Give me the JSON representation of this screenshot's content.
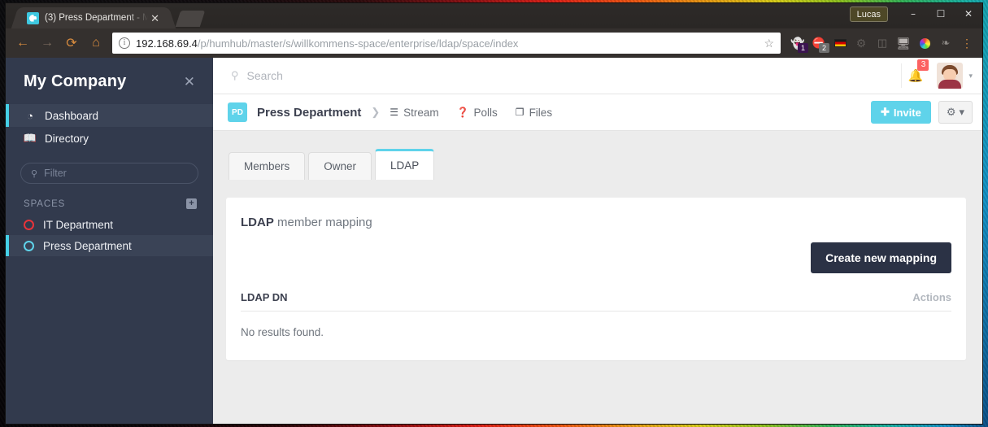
{
  "browser": {
    "tab": {
      "title": "(3) Press Department - M",
      "favicon": "humhub-logo-icon",
      "close": "✕"
    },
    "nav": {
      "back": "←",
      "forward": "→",
      "reload": "⟳",
      "home": "⌂"
    },
    "url": {
      "host": "192.168.69.4",
      "path": "/p/humhub/master/s/willkommens-space/enterprise/ldap/space/index",
      "info_icon": "info-icon",
      "star": "☆"
    },
    "extensions": [
      {
        "name": "ghostery-extension-icon",
        "glyph": "👻",
        "badge": "1",
        "badge_color": "#3b1450"
      },
      {
        "name": "adblock-extension-icon",
        "glyph": "✋",
        "badge": "2",
        "badge_color": "#6e6e6e"
      },
      {
        "name": "german-flag-icon",
        "glyph": "▬"
      },
      {
        "name": "gear-extension-icon",
        "glyph": "⚙"
      },
      {
        "name": "cast-icon",
        "glyph": "⎕"
      },
      {
        "name": "screen-icon",
        "glyph": "🖥"
      },
      {
        "name": "color-wheel-icon",
        "glyph": "✹"
      },
      {
        "name": "leaf-icon",
        "glyph": "❧"
      },
      {
        "name": "chrome-menu-icon",
        "glyph": "⋮"
      }
    ],
    "profile_chip": "Lucas",
    "window_buttons": {
      "minimize": "–",
      "maximize": "☐",
      "close": "✕"
    }
  },
  "sidebar": {
    "title": "My Company",
    "close": "✕",
    "items": [
      {
        "label": "Dashboard",
        "icon": "dashboard-icon",
        "glyph": "◔",
        "active": true
      },
      {
        "label": "Directory",
        "icon": "directory-icon",
        "glyph": "▤",
        "active": false
      }
    ],
    "filter": {
      "placeholder": "Filter",
      "value": "",
      "icon": "search-icon"
    },
    "spaces_label": "SPACES",
    "spaces_add": "+",
    "spaces": [
      {
        "label": "IT Department",
        "color": "#e8333a",
        "active": false
      },
      {
        "label": "Press Department",
        "color": "#5fd3ea",
        "active": true
      }
    ]
  },
  "topnav": {
    "search_placeholder": "Search",
    "search_value": "",
    "notifications_count": "3",
    "avatar": "user-avatar",
    "caret": "▾"
  },
  "spacebar": {
    "badge": "PD",
    "name": "Press Department",
    "chevron": "❯",
    "links": [
      {
        "label": "Stream",
        "icon": "stream-icon",
        "glyph": "☰"
      },
      {
        "label": "Polls",
        "icon": "polls-icon",
        "glyph": "❓"
      },
      {
        "label": "Files",
        "icon": "files-icon",
        "glyph": "❐"
      }
    ],
    "invite_label": "Invite",
    "invite_plus": "✚",
    "gear_glyph": "⚙",
    "gear_caret": "▾"
  },
  "content": {
    "tabs": [
      {
        "label": "Members",
        "active": false
      },
      {
        "label": "Owner",
        "active": false
      },
      {
        "label": "LDAP",
        "active": true
      }
    ],
    "panel": {
      "title_bold": "LDAP",
      "title_rest": " member mapping",
      "create_button": "Create new mapping",
      "table": {
        "columns": [
          "LDAP DN",
          "Actions"
        ],
        "rows": [],
        "empty_text": "No results found."
      }
    }
  },
  "colors": {
    "accent_cyan": "#5fd3ea",
    "sidebar_bg": "#323a4d",
    "dark_button": "#2b3245",
    "badge_red": "#fc6161",
    "space_red": "#e8333a"
  }
}
